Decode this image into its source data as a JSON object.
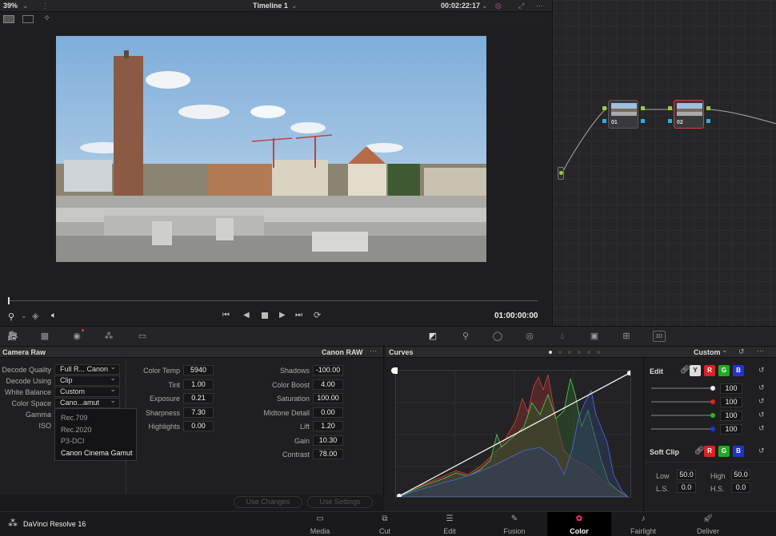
{
  "viewer": {
    "zoom": "39%",
    "timeline": "Timeline 1",
    "timecode": "00:02:22:17",
    "playhead_tc": "01:00:00:00"
  },
  "nodes": [
    {
      "label": "01"
    },
    {
      "label": "02"
    }
  ],
  "camera_raw": {
    "title": "Camera Raw",
    "mode": "Canon RAW",
    "left": [
      {
        "label": "Decode Quality",
        "value": "Full R... Canon"
      },
      {
        "label": "Decode Using",
        "value": "Clip"
      },
      {
        "label": "White Balance",
        "value": "Custom"
      },
      {
        "label": "Color Space",
        "value": "Cano...amut"
      },
      {
        "label": "Gamma",
        "value": ""
      },
      {
        "label": "ISO",
        "value": ""
      }
    ],
    "dropdown": [
      "Rec.709",
      "Rec.2020",
      "P3-DCI",
      "Canon Cinema Gamut"
    ],
    "mid": [
      {
        "label": "Color Temp",
        "value": "5940"
      },
      {
        "label": "Tint",
        "value": "1.00"
      },
      {
        "label": "Exposure",
        "value": "0.21"
      },
      {
        "label": "Sharpness",
        "value": "7.30"
      },
      {
        "label": "Highlights",
        "value": "0.00"
      }
    ],
    "right": [
      {
        "label": "Shadows",
        "value": "-100.00"
      },
      {
        "label": "Color Boost",
        "value": "4.00"
      },
      {
        "label": "Saturation",
        "value": "100.00"
      },
      {
        "label": "Midtone Detail",
        "value": "0.00"
      },
      {
        "label": "Lift",
        "value": "1.20"
      },
      {
        "label": "Gain",
        "value": "10.30"
      },
      {
        "label": "Contrast",
        "value": "78.00"
      }
    ],
    "use_changes": "Use Changes",
    "use_settings": "Use Settings"
  },
  "curves": {
    "title": "Curves",
    "preset": "Custom",
    "edit_label": "Edit",
    "y": "Y",
    "r": "R",
    "g": "G",
    "b": "B",
    "edit_values": [
      "100",
      "100",
      "100",
      "100"
    ],
    "soft_clip": "Soft Clip",
    "low_label": "Low",
    "low": "50.0",
    "high_label": "High",
    "high": "50.0",
    "ls_label": "L.S.",
    "ls": "0.0",
    "hs_label": "H.S.",
    "hs": "0.0"
  },
  "app": {
    "name": "DaVinci Resolve 16"
  },
  "pages": [
    {
      "label": "Media"
    },
    {
      "label": "Cut"
    },
    {
      "label": "Edit"
    },
    {
      "label": "Fusion"
    },
    {
      "label": "Color"
    },
    {
      "label": "Fairlight"
    },
    {
      "label": "Deliver"
    }
  ],
  "colors": {
    "accent": "#e3514f",
    "active_page": "#000000"
  }
}
